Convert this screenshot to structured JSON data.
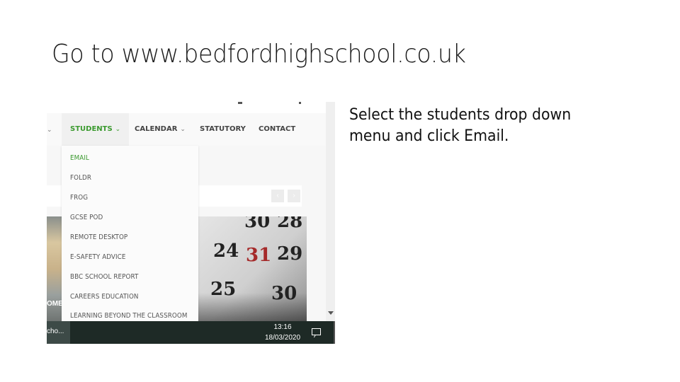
{
  "slide": {
    "title": "Go to www.bedfordhighschool.co.uk",
    "instruction": "Select the students drop down menu and click Email."
  },
  "screenshot": {
    "nav": {
      "items": [
        {
          "label": "STUDENTS",
          "has_dropdown": true,
          "active": true
        },
        {
          "label": "CALENDAR",
          "has_dropdown": true,
          "active": false
        },
        {
          "label": "STATUTORY",
          "has_dropdown": false,
          "active": false
        },
        {
          "label": "CONTACT",
          "has_dropdown": false,
          "active": false
        }
      ],
      "chevron_glyph": "⌄",
      "accent_color": "#3b9a2f"
    },
    "students_dropdown": {
      "items": [
        {
          "label": "EMAIL",
          "highlighted": true
        },
        {
          "label": "FOLDR",
          "highlighted": false
        },
        {
          "label": "FROG",
          "highlighted": false
        },
        {
          "label": "GCSE POD",
          "highlighted": false
        },
        {
          "label": "REMOTE DESKTOP",
          "highlighted": false
        },
        {
          "label": "E-SAFETY ADVICE",
          "highlighted": false
        },
        {
          "label": "BBC SCHOOL REPORT",
          "highlighted": false
        },
        {
          "label": "CAREERS EDUCATION",
          "highlighted": false
        },
        {
          "label": "LEARNING BEYOND THE CLASSROOM",
          "highlighted": false
        }
      ]
    },
    "pager": {
      "prev": "‹",
      "next": "›"
    },
    "tiles": {
      "left_caption": "OME",
      "calendar_caption": "R",
      "calendar_numbers": [
        "30",
        "28",
        "24",
        "31",
        "29",
        "25",
        "30"
      ]
    },
    "taskbar": {
      "app_label": "cho...",
      "time": "13:16",
      "date": "18/03/2020"
    }
  }
}
